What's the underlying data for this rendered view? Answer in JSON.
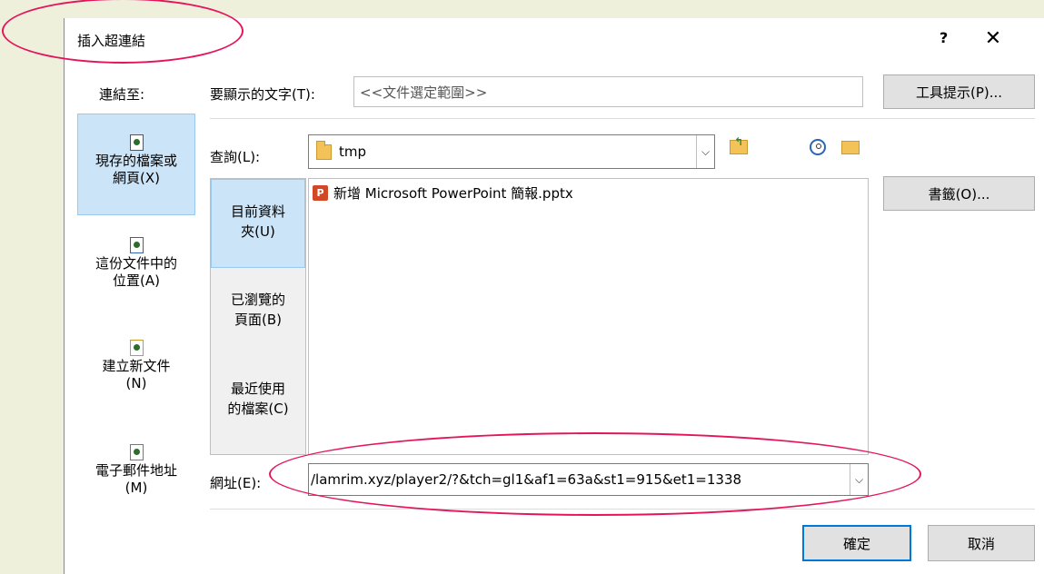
{
  "dialog": {
    "title": "插入超連結",
    "help": "?",
    "close": "✕"
  },
  "link_to": "連結至:",
  "places": [
    {
      "line1": "現存的檔案或",
      "line2": "網頁(X)",
      "icon": "existing-file-icon"
    },
    {
      "line1": "這份文件中的",
      "line2": "位置(A)",
      "icon": "place-in-doc-icon"
    },
    {
      "line1": "建立新文件",
      "line2": "(N)",
      "icon": "new-doc-icon"
    },
    {
      "line1": "電子郵件地址",
      "line2": "(M)",
      "icon": "email-icon"
    }
  ],
  "text_to_display": {
    "label": "要顯示的文字(T):",
    "value": "<<文件選定範圍>>"
  },
  "screentip_button": "工具提示(P)...",
  "look_in": {
    "label": "查詢(L):",
    "value": "tmp"
  },
  "sub_places": [
    {
      "line1": "目前資料",
      "line2": "夾(U)"
    },
    {
      "line1": "已瀏覽的",
      "line2": "頁面(B)"
    },
    {
      "line1": "最近使用",
      "line2": "的檔案(C)"
    }
  ],
  "files": [
    {
      "name": "新增 Microsoft PowerPoint 簡報.pptx",
      "icon": "powerpoint-icon"
    }
  ],
  "bookmark_button": "書籤(O)...",
  "address": {
    "label": "網址(E):",
    "value": "/lamrim.xyz/player2/?&tch=gl1&af1=63a&st1=915&et1=1338"
  },
  "ok_button": "確定",
  "cancel_button": "取消",
  "colors": {
    "background": "#eef0dc",
    "selection": "#cce4f7",
    "highlight_ellipse": "#e4155c",
    "default_button_border": "#0078d7"
  }
}
